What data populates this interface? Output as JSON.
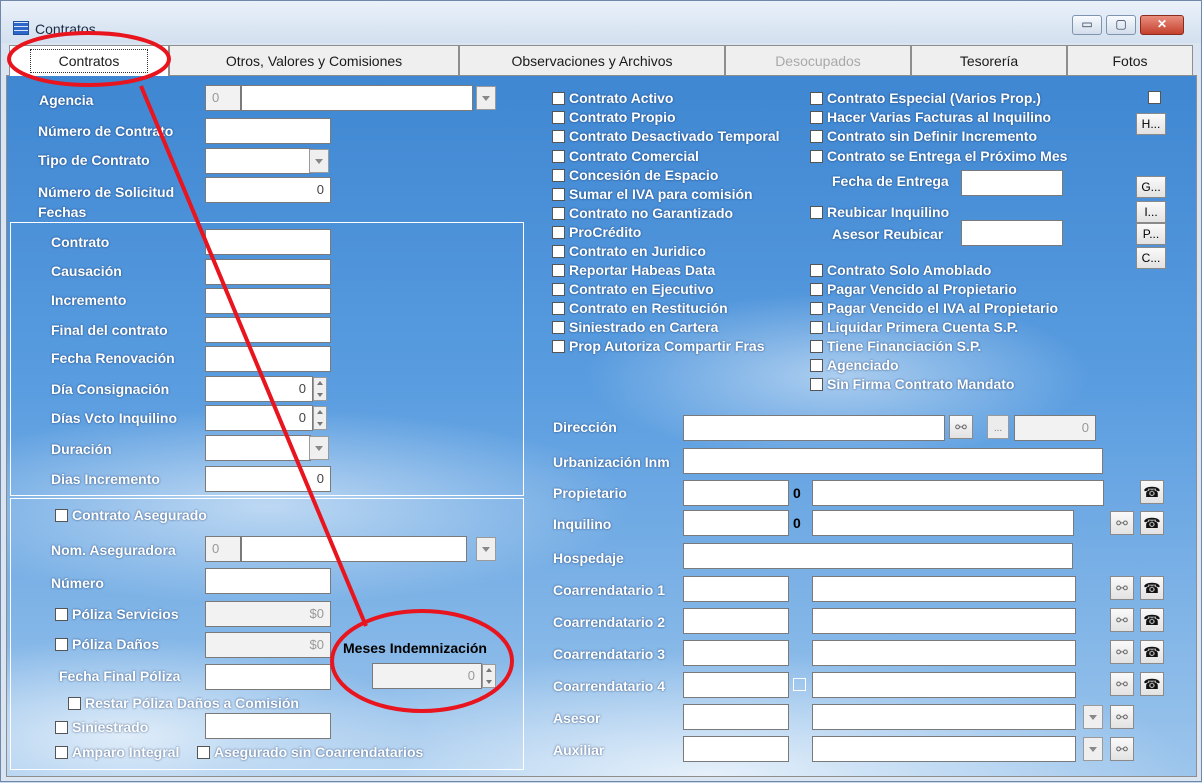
{
  "window": {
    "title": "Contratos",
    "minimize_icon": "minimize-icon",
    "maximize_icon": "maximize-icon",
    "close_icon": "close-icon"
  },
  "tabs": [
    {
      "label": "Contratos",
      "state": "active"
    },
    {
      "label": "Otros, Valores y Comisiones",
      "state": "normal"
    },
    {
      "label": "Observaciones y Archivos",
      "state": "normal"
    },
    {
      "label": "Desocupados",
      "state": "disabled"
    },
    {
      "label": "Tesorería",
      "state": "normal"
    },
    {
      "label": "Fotos",
      "state": "normal"
    }
  ],
  "left": {
    "agencia": {
      "label": "Agencia",
      "code": "0",
      "value": ""
    },
    "numero_contrato": {
      "label": "Número de Contrato",
      "value": ""
    },
    "tipo_contrato": {
      "label": "Tipo de Contrato",
      "value": ""
    },
    "numero_solicitud": {
      "label": "Número de Solicitud",
      "value": "0"
    },
    "fechas_label": "Fechas",
    "fechas": [
      {
        "label": "Contrato",
        "value": ""
      },
      {
        "label": "Causación",
        "value": ""
      },
      {
        "label": "Incremento",
        "value": ""
      },
      {
        "label": "Final del contrato",
        "value": ""
      },
      {
        "label": "Fecha Renovación",
        "value": ""
      }
    ],
    "dia_consignacion": {
      "label": "Día Consignación",
      "value": "0"
    },
    "dias_vcto_inquilino": {
      "label": "Días Vcto Inquilino",
      "value": "0"
    },
    "duracion": {
      "label": "Duración",
      "value": ""
    },
    "dias_incremento": {
      "label": "Dias Incremento",
      "value": "0"
    }
  },
  "seguro": {
    "contrato_asegurado": "Contrato Asegurado",
    "nom_aseguradora": {
      "label": "Nom. Aseguradora",
      "code": "0",
      "value": ""
    },
    "numero": {
      "label": "Número",
      "value": ""
    },
    "poliza_servicios": {
      "label": "Póliza Servicios",
      "value": "$0"
    },
    "poliza_danos": {
      "label": "Póliza Daños",
      "value": "$0"
    },
    "meses_indemnizacion": {
      "label": "Meses Indemnización",
      "value": "0"
    },
    "fecha_final_poliza": {
      "label": "Fecha Final Póliza",
      "value": ""
    },
    "restar_poliza": "Restar Póliza Daños a Comisión",
    "siniestrado": {
      "label": "Siniestrado",
      "value": ""
    },
    "amparo_integral": "Amparo Integral",
    "asegurado_sin_coarr": "Asegurado sin Coarrendatarios"
  },
  "checks_col1": [
    "Contrato Activo",
    "Contrato Propio",
    "Contrato Desactivado Temporal",
    "Contrato Comercial",
    "Concesión de Espacio",
    "Sumar el IVA para comisión",
    "Contrato no Garantizado",
    "ProCrédito",
    "Contrato en Juridico",
    "Reportar Habeas Data",
    "Contrato en Ejecutivo",
    "Contrato en Restitución",
    "Siniestrado en Cartera",
    "Prop Autoriza Compartir Fras"
  ],
  "checks_col2_top": [
    "Contrato Especial (Varios Prop.)",
    "Hacer Varias Facturas al Inquilino",
    "Contrato sin Definir Incremento",
    "Contrato se Entrega el Próximo Mes"
  ],
  "fecha_entrega": {
    "label": "Fecha de Entrega",
    "value": ""
  },
  "reubicar_inquilino": "Reubicar Inquilino",
  "asesor_reubicar": {
    "label": "Asesor Reubicar",
    "value": ""
  },
  "checks_col2_bottom": [
    "Contrato Solo Amoblado",
    "Pagar Vencido al Propietario",
    "Pagar Vencido el IVA al Propietario",
    "Liquidar Primera Cuenta S.P.",
    "Tiene Financiación S.P.",
    "Agenciado",
    "Sin Firma Contrato Mandato"
  ],
  "side_buttons": [
    "H...",
    "G...",
    "I...",
    "P...",
    "C..."
  ],
  "right": {
    "direccion": {
      "label": "Dirección",
      "value": "",
      "number": "0"
    },
    "urbanizacion": {
      "label": "Urbanización Inm",
      "value": ""
    },
    "propietario": {
      "label": "Propietario",
      "code": "",
      "id": "0",
      "name": ""
    },
    "inquilino": {
      "label": "Inquilino",
      "code": "",
      "id": "0",
      "name": ""
    },
    "hospedaje": {
      "label": "Hospedaje",
      "value": ""
    },
    "coarr1": {
      "label": "Coarrendatario 1"
    },
    "coarr2": {
      "label": "Coarrendatario 2"
    },
    "coarr3": {
      "label": "Coarrendatario 3"
    },
    "coarr4": {
      "label": "Coarrendatario 4"
    },
    "asesor": {
      "label": "Asesor"
    },
    "auxiliar": {
      "label": "Auxiliar"
    }
  },
  "icons": {
    "search": "binoculars-icon",
    "phone": "telephone-icon",
    "ellipsis": "..."
  },
  "annotation_color": "#e8141e"
}
